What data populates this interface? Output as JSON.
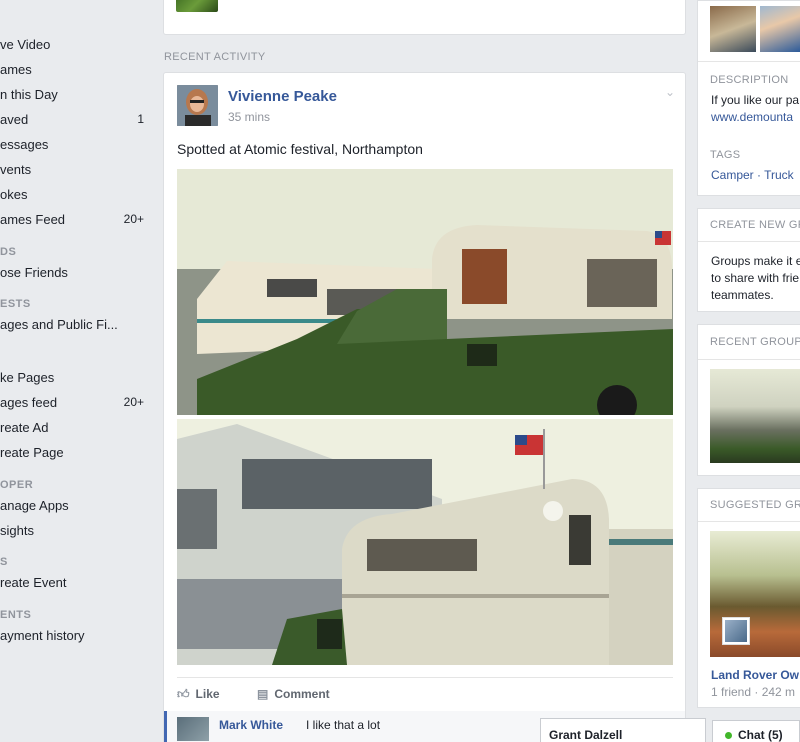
{
  "sidebar": {
    "items": [
      {
        "label": "ve Video",
        "count": ""
      },
      {
        "label": "ames",
        "count": ""
      },
      {
        "label": "n this Day",
        "count": ""
      },
      {
        "label": "aved",
        "count": "1"
      },
      {
        "label": "essages",
        "count": ""
      },
      {
        "label": "vents",
        "count": ""
      },
      {
        "label": "okes",
        "count": ""
      },
      {
        "label": "ames Feed",
        "count": "20+"
      }
    ],
    "head_groups": "DS",
    "groups_item": "ose Friends",
    "head_interests": "ESTS",
    "interests_item": "ages and Public Fi...",
    "pages_items": [
      {
        "label": "ke Pages",
        "count": ""
      },
      {
        "label": "ages feed",
        "count": "20+"
      },
      {
        "label": "reate Ad",
        "count": ""
      },
      {
        "label": "reate Page",
        "count": ""
      }
    ],
    "head_developer": "OPER",
    "developer_items": [
      {
        "label": "anage Apps"
      },
      {
        "label": "sights"
      }
    ],
    "head_events": "S",
    "events_item": "reate Event",
    "head_payments": "ENTS",
    "payments_item": "ayment history"
  },
  "feed": {
    "section_label": "RECENT ACTIVITY",
    "post": {
      "author": "Vivienne Peake",
      "time": "35 mins",
      "caption": "Spotted at Atomic festival, Northampton",
      "like_label": "Like",
      "comment_label": "Comment"
    },
    "comment": {
      "author": "Mark White",
      "text": "I like that a lot"
    }
  },
  "right": {
    "description_head": "DESCRIPTION",
    "description_text": "If you like our pa",
    "description_link": "www.demounta",
    "tags_head": "TAGS",
    "tags_text": "Camper · Truck",
    "create_head": "CREATE NEW GR",
    "create_lines": [
      "Groups make it e",
      "to share with frie",
      "teammates."
    ],
    "recent_head": "RECENT GROUP",
    "suggested_head": "SUGGESTED GRO",
    "suggested_name": "Land Rover Ow",
    "suggested_meta": "1 friend · 242 m"
  },
  "chat": {
    "contact": "Grant Dalzell",
    "button": "Chat (5)"
  }
}
